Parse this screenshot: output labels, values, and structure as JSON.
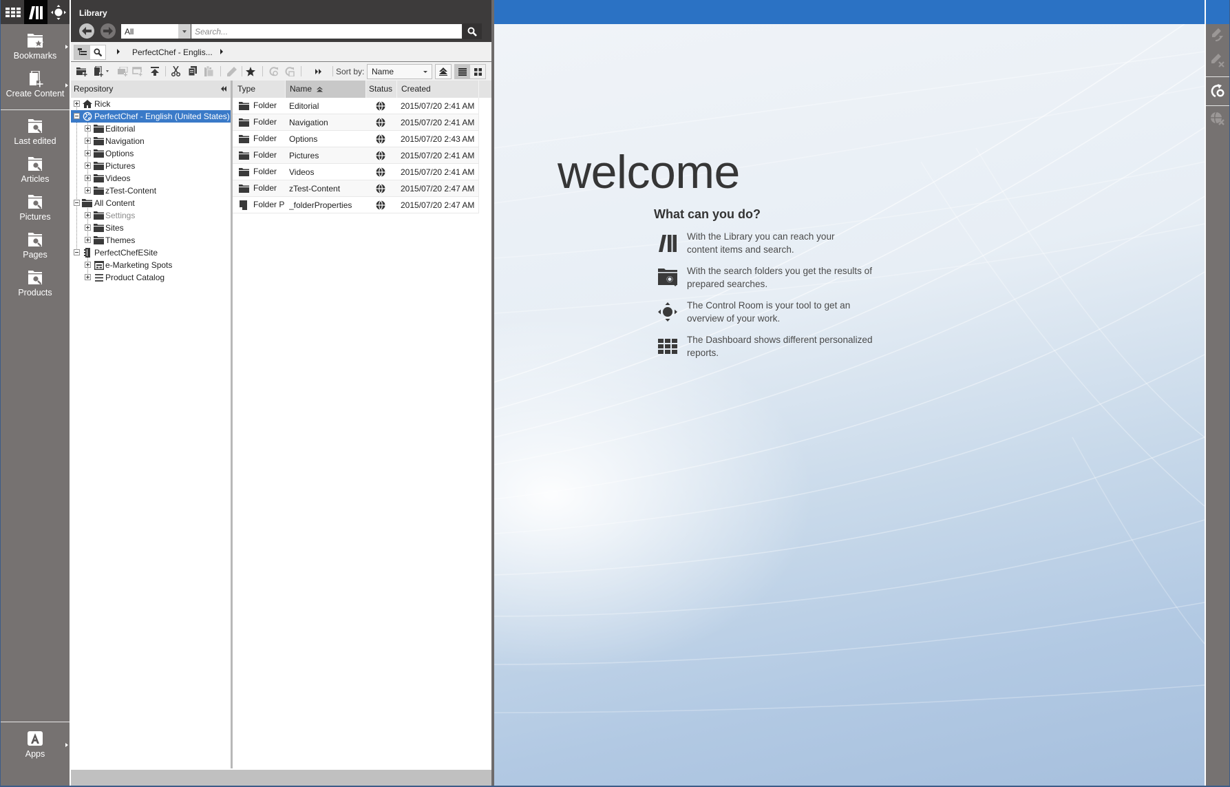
{
  "colors": {
    "header_dark": "#3d3b3b",
    "sidebar_gray": "#767271",
    "accent_blue": "#2b72c4",
    "selection_blue": "#3a7ac8",
    "status_bar": "#c0c0c0"
  },
  "nav_sidebar": {
    "top_icons": [
      {
        "icon": "apps-grid-icon",
        "active": false
      },
      {
        "icon": "library-icon",
        "active": true
      },
      {
        "icon": "control-room-icon",
        "active": false
      }
    ],
    "items": [
      {
        "label": "Bookmarks",
        "icon": "bookmarks-folder-icon",
        "has_submenu": true
      },
      {
        "label": "Create Content",
        "icon": "create-content-icon",
        "has_submenu": true
      },
      {
        "label": "Last edited",
        "icon": "search-folder-icon",
        "has_submenu": false
      },
      {
        "label": "Articles",
        "icon": "search-folder-icon",
        "has_submenu": false
      },
      {
        "label": "Pictures",
        "icon": "search-folder-icon",
        "has_submenu": false
      },
      {
        "label": "Pages",
        "icon": "search-folder-icon",
        "has_submenu": false
      },
      {
        "label": "Products",
        "icon": "search-folder-icon",
        "has_submenu": false
      }
    ],
    "apps": {
      "label": "Apps",
      "icon": "apps-icon",
      "has_submenu": true
    }
  },
  "library": {
    "title": "Library",
    "navigation": {
      "back_enabled": true,
      "forward_enabled": false
    },
    "filter": {
      "selected": "All"
    },
    "search": {
      "placeholder": "Search...",
      "value": ""
    },
    "view_toggle": {
      "options": [
        "tree",
        "search"
      ],
      "selected": "tree"
    },
    "breadcrumb": [
      "PerfectChef - Englis..."
    ],
    "toolbar": {
      "buttons": [
        {
          "icon": "new-folder-icon",
          "enabled": true
        },
        {
          "icon": "new-content-icon",
          "enabled": true,
          "dropdown": true
        },
        {
          "icon": "copy-to-icon",
          "enabled": false
        },
        {
          "icon": "create-from-template-icon",
          "enabled": false
        },
        {
          "icon": "move-up-icon",
          "enabled": true
        },
        {
          "icon": "cut-icon",
          "enabled": true
        },
        {
          "icon": "copy-icon",
          "enabled": true
        },
        {
          "icon": "paste-icon",
          "enabled": false
        },
        {
          "icon": "edit-icon",
          "enabled": false
        },
        {
          "icon": "bookmark-star-icon",
          "enabled": true
        },
        {
          "icon": "checkin-icon",
          "enabled": false
        },
        {
          "icon": "checkout-icon",
          "enabled": false
        },
        {
          "icon": "more-icon",
          "enabled": true
        }
      ],
      "sort_by_label": "Sort by:",
      "sort_by_value": "Name",
      "sort_direction": "ascending",
      "view_mode": "list"
    },
    "tree": {
      "header": "Repository",
      "nodes": [
        {
          "label": "Rick",
          "level": 0,
          "expander": "plus",
          "icon": "home-icon"
        },
        {
          "label": "PerfectChef - English (United States)",
          "level": 0,
          "expander": "minus",
          "icon": "site-globe-icon",
          "selected": true
        },
        {
          "label": "Editorial",
          "level": 1,
          "expander": "plus",
          "icon": "folder-icon"
        },
        {
          "label": "Navigation",
          "level": 1,
          "expander": "plus",
          "icon": "folder-icon"
        },
        {
          "label": "Options",
          "level": 1,
          "expander": "plus",
          "icon": "folder-icon"
        },
        {
          "label": "Pictures",
          "level": 1,
          "expander": "plus",
          "icon": "folder-icon"
        },
        {
          "label": "Videos",
          "level": 1,
          "expander": "plus",
          "icon": "folder-icon"
        },
        {
          "label": "zTest-Content",
          "level": 1,
          "expander": "plus",
          "icon": "folder-icon"
        },
        {
          "label": "All Content",
          "level": 0,
          "expander": "minus",
          "icon": "folder-icon"
        },
        {
          "label": "Settings",
          "level": 1,
          "expander": "plus",
          "icon": "folder-icon",
          "dimmed": true
        },
        {
          "label": "Sites",
          "level": 1,
          "expander": "plus",
          "icon": "folder-icon"
        },
        {
          "label": "Themes",
          "level": 1,
          "expander": "plus",
          "icon": "folder-icon"
        },
        {
          "label": "PerfectChefESite",
          "level": 0,
          "expander": "minus",
          "icon": "esite-icon"
        },
        {
          "label": "e-Marketing Spots",
          "level": 1,
          "expander": "plus",
          "icon": "marketing-spots-icon"
        },
        {
          "label": "Product Catalog",
          "level": 1,
          "expander": "plus",
          "icon": "catalog-list-icon"
        }
      ]
    },
    "table": {
      "columns": [
        "Type",
        "Name",
        "Status",
        "Created"
      ],
      "sorted_column": "Name",
      "sort_direction": "ascending",
      "rows": [
        {
          "type": "Folder",
          "name": "Editorial",
          "status": "published",
          "created": "2015/07/20 2:41 AM"
        },
        {
          "type": "Folder",
          "name": "Navigation",
          "status": "published",
          "created": "2015/07/20 2:41 AM"
        },
        {
          "type": "Folder",
          "name": "Options",
          "status": "published",
          "created": "2015/07/20 2:43 AM"
        },
        {
          "type": "Folder",
          "name": "Pictures",
          "status": "published",
          "created": "2015/07/20 2:41 AM"
        },
        {
          "type": "Folder",
          "name": "Videos",
          "status": "published",
          "created": "2015/07/20 2:41 AM"
        },
        {
          "type": "Folder",
          "name": "zTest-Content",
          "status": "published",
          "created": "2015/07/20 2:47 AM"
        },
        {
          "type": "Folder Properties",
          "name": "_folderProperties",
          "status": "published",
          "created": "2015/07/20 2:47 AM"
        }
      ]
    }
  },
  "welcome": {
    "title": "welcome",
    "subtitle": "What can you do?",
    "items": [
      {
        "icon": "library-icon",
        "lines": [
          "With the Library you can reach your",
          "content items and search."
        ]
      },
      {
        "icon": "search-folder-icon",
        "lines": [
          "With the search folders you get the results of",
          "prepared searches."
        ]
      },
      {
        "icon": "control-room-icon",
        "lines": [
          "The Control Room is your tool to get an",
          "overview of your work."
        ]
      },
      {
        "icon": "dashboard-grid-icon",
        "lines": [
          "The Dashboard shows different personalized",
          "reports."
        ]
      }
    ]
  },
  "right_sidebar": {
    "buttons": [
      {
        "icon": "revert-edit-icon",
        "enabled": false
      },
      {
        "icon": "discard-edit-icon",
        "enabled": false
      },
      {
        "icon": "publish-icon",
        "enabled": true
      },
      {
        "icon": "withdraw-icon",
        "enabled": false
      }
    ]
  }
}
